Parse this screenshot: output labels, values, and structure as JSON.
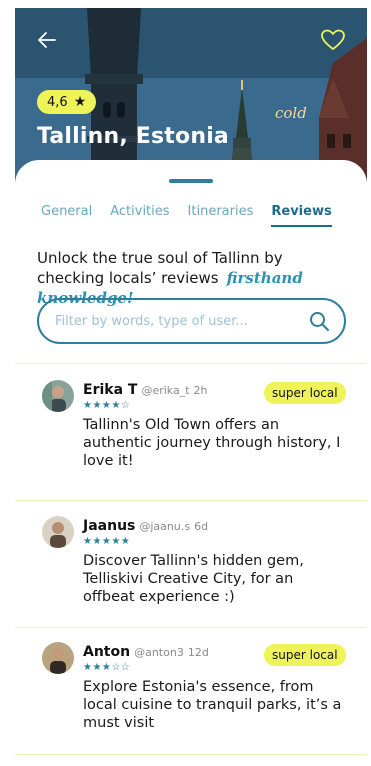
{
  "hero": {
    "rating": "4,6",
    "rating_icon": "star-icon",
    "title": "Tallinn, Estonia",
    "weather": "cold",
    "back_icon": "arrow-left-icon",
    "favorite_icon": "heart-outline-icon"
  },
  "tabs": [
    {
      "label": "General",
      "active": false
    },
    {
      "label": "Activities",
      "active": false
    },
    {
      "label": "Itineraries",
      "active": false
    },
    {
      "label": "Reviews",
      "active": true
    }
  ],
  "intro": {
    "text": "Unlock the true soul of Tallinn by checking locals’ reviews",
    "highlight": "firsthand knowledge!"
  },
  "search": {
    "placeholder": "Filter by words, type of user...",
    "icon": "search-icon"
  },
  "reviews": [
    {
      "name": "Erika T",
      "handle": "@erika_t",
      "time": "2h",
      "stars": "★★★★☆",
      "rating": 4,
      "badge": "super local",
      "text": "Tallinn's Old Town offers an authentic journey through history, I love it!"
    },
    {
      "name": "Jaanus",
      "handle": "@jaanu.s",
      "time": "6d",
      "stars": "★★★★★",
      "rating": 5,
      "badge": "",
      "text": "Discover Tallinn's hidden gem, Telliskivi Creative City, for an offbeat experience :)"
    },
    {
      "name": "Anton",
      "handle": "@anton3",
      "time": "12d",
      "stars": "★★★☆☆",
      "rating": 3,
      "badge": "super local",
      "text": "Explore Estonia's essence, from local cuisine to tranquil parks, it’s a must visit"
    }
  ],
  "colors": {
    "accent": "#2f7e9c",
    "highlight": "#eef35a",
    "tab_inactive": "#6aa7bc"
  }
}
